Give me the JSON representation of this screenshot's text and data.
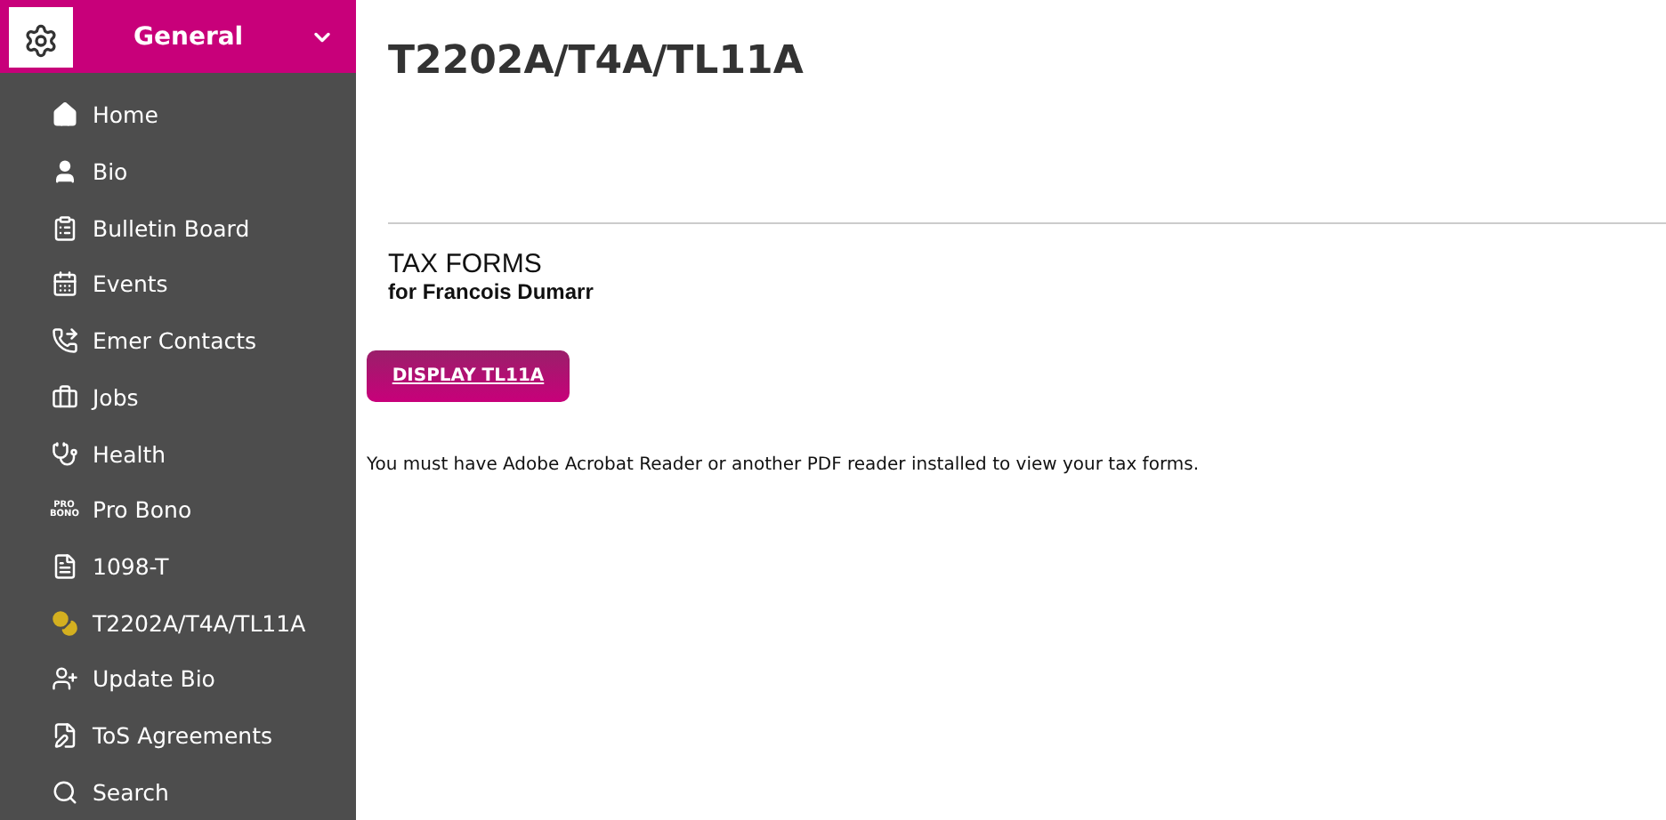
{
  "sidebar": {
    "header": {
      "title": "General",
      "expanded": true
    },
    "items": [
      {
        "label": "Home"
      },
      {
        "label": "Bio"
      },
      {
        "label": "Bulletin Board"
      },
      {
        "label": "Events"
      },
      {
        "label": "Emer Contacts"
      },
      {
        "label": "Jobs"
      },
      {
        "label": "Health"
      },
      {
        "label": "Pro Bono",
        "icon_text": "PRO BONO"
      },
      {
        "label": "1098-T"
      },
      {
        "label": "T2202A/T4A/TL11A"
      },
      {
        "label": "Update Bio"
      },
      {
        "label": "ToS Agreements"
      },
      {
        "label": "Search"
      }
    ]
  },
  "main": {
    "title": "T2202A/T4A/TL11A",
    "section_title": "TAX FORMS",
    "section_subtitle": "for Francois Dumarr",
    "button": "DISPLAY TL11A",
    "note": "You must have Adobe Acrobat Reader or another PDF reader installed to view your tax forms."
  }
}
